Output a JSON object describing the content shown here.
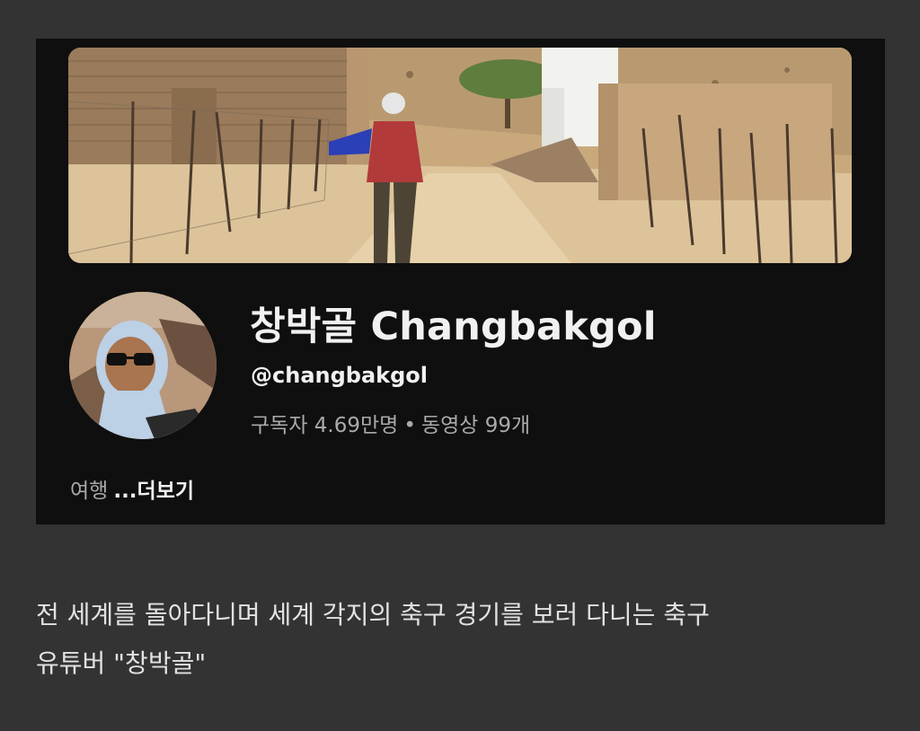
{
  "channel": {
    "name": "창박골 Changbakgol",
    "handle": "@changbakgol",
    "subscribers": "구독자 4.69만명",
    "separator": "•",
    "videos": "동영상 99개",
    "description": "여행",
    "more_label": "...더보기"
  },
  "caption": {
    "line1": "전 세계를 돌아다니며 세계 각지의 축구 경기를 보러 다니는 축구",
    "line2": "유튜버 \"창박골\""
  },
  "colors": {
    "background": "#333333",
    "card": "#0f0f0f",
    "primary_text": "#f1f1f1",
    "secondary_text": "#aaaaaa"
  }
}
